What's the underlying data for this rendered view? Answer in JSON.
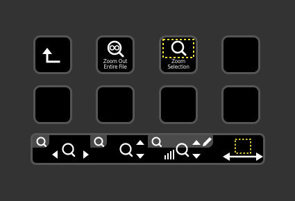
{
  "keys": {
    "back": {
      "icon": "return-arrow-icon"
    },
    "zoom_out": {
      "label_line1": "Zoom Out",
      "label_line2": "Entire File",
      "icon": "zoom-out-entire-icon"
    },
    "zoom_selection": {
      "label_line1": "Zoom",
      "label_line2": "Selection",
      "icon": "zoom-selection-icon"
    }
  },
  "dials": [
    {
      "icon": "magnifier-icon",
      "action": "horizontal-zoom"
    },
    {
      "icon": "magnifier-icon",
      "action": "vertical-zoom"
    },
    {
      "icon": "magnifier-icon",
      "action": "waveform-zoom",
      "extra_icon": "pencil-icon"
    },
    {
      "icon": "selection-resize-icon",
      "action": "selection"
    }
  ],
  "colors": {
    "accent": "#f0e040",
    "key_border": "#555555",
    "tab_bg": "#4a4a4a"
  }
}
